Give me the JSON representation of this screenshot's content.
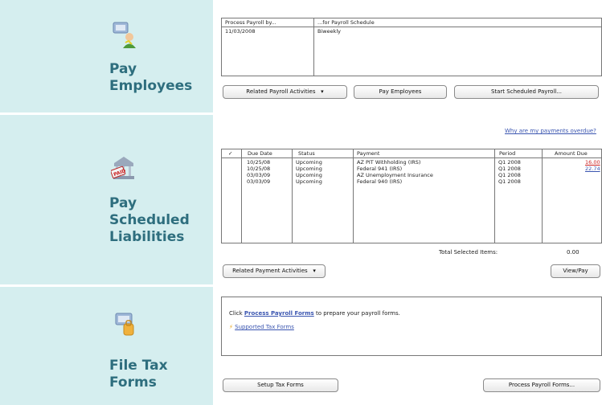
{
  "payroll": {
    "title_line1": "Pay",
    "title_line2": "Employees",
    "table": {
      "headers": [
        "Process Payroll by...",
        "...for Payroll Schedule"
      ],
      "rows": [
        [
          "11/03/2008",
          "Biweekly"
        ]
      ]
    },
    "buttons": {
      "related": "Related Payroll Activities",
      "pay": "Pay Employees",
      "start": "Start Scheduled Payroll..."
    }
  },
  "liabilities": {
    "title_line1": "Pay",
    "title_line2": "Scheduled",
    "title_line3": "Liabilities",
    "overdue_link": "Why are my payments overdue?",
    "table": {
      "headers": {
        "check": "✓",
        "due": "Due Date",
        "status": "Status",
        "payment": "Payment",
        "period": "Period",
        "amount": "Amount Due"
      },
      "rows": [
        {
          "due": "10/25/08",
          "status": "Upcoming",
          "payment": "AZ PIT Withholding (IRS)",
          "period": "Q1 2008",
          "amount": "16.00"
        },
        {
          "due": "10/25/08",
          "status": "Upcoming",
          "payment": "Federal 941 (IRS)",
          "period": "Q1 2008",
          "amount": "22.74"
        },
        {
          "due": "03/03/09",
          "status": "Upcoming",
          "payment": "AZ Unemployment Insurance",
          "period": "Q1 2008",
          "amount": ""
        },
        {
          "due": "03/03/09",
          "status": "Upcoming",
          "payment": "Federal 940 (IRS)",
          "period": "Q1 2008",
          "amount": ""
        }
      ]
    },
    "total_label": "Total Selected Items:",
    "total_value": "0.00",
    "buttons": {
      "related": "Related Payment Activities",
      "view_pay": "View/Pay"
    }
  },
  "forms": {
    "title_line1": "File Tax",
    "title_line2": "Forms",
    "info_prefix": "Click",
    "info_link": "Process Payroll Forms",
    "info_suffix": "to prepare your payroll forms.",
    "supported_link": "Supported Tax Forms",
    "buttons": {
      "setup": "Setup Tax Forms",
      "process": "Process Payroll Forms..."
    }
  },
  "colors": {
    "left_panel": "#d5eeef",
    "title_text": "#2e6e7e",
    "link": "#3a55b0",
    "overdue_amount": "#cc2222"
  }
}
